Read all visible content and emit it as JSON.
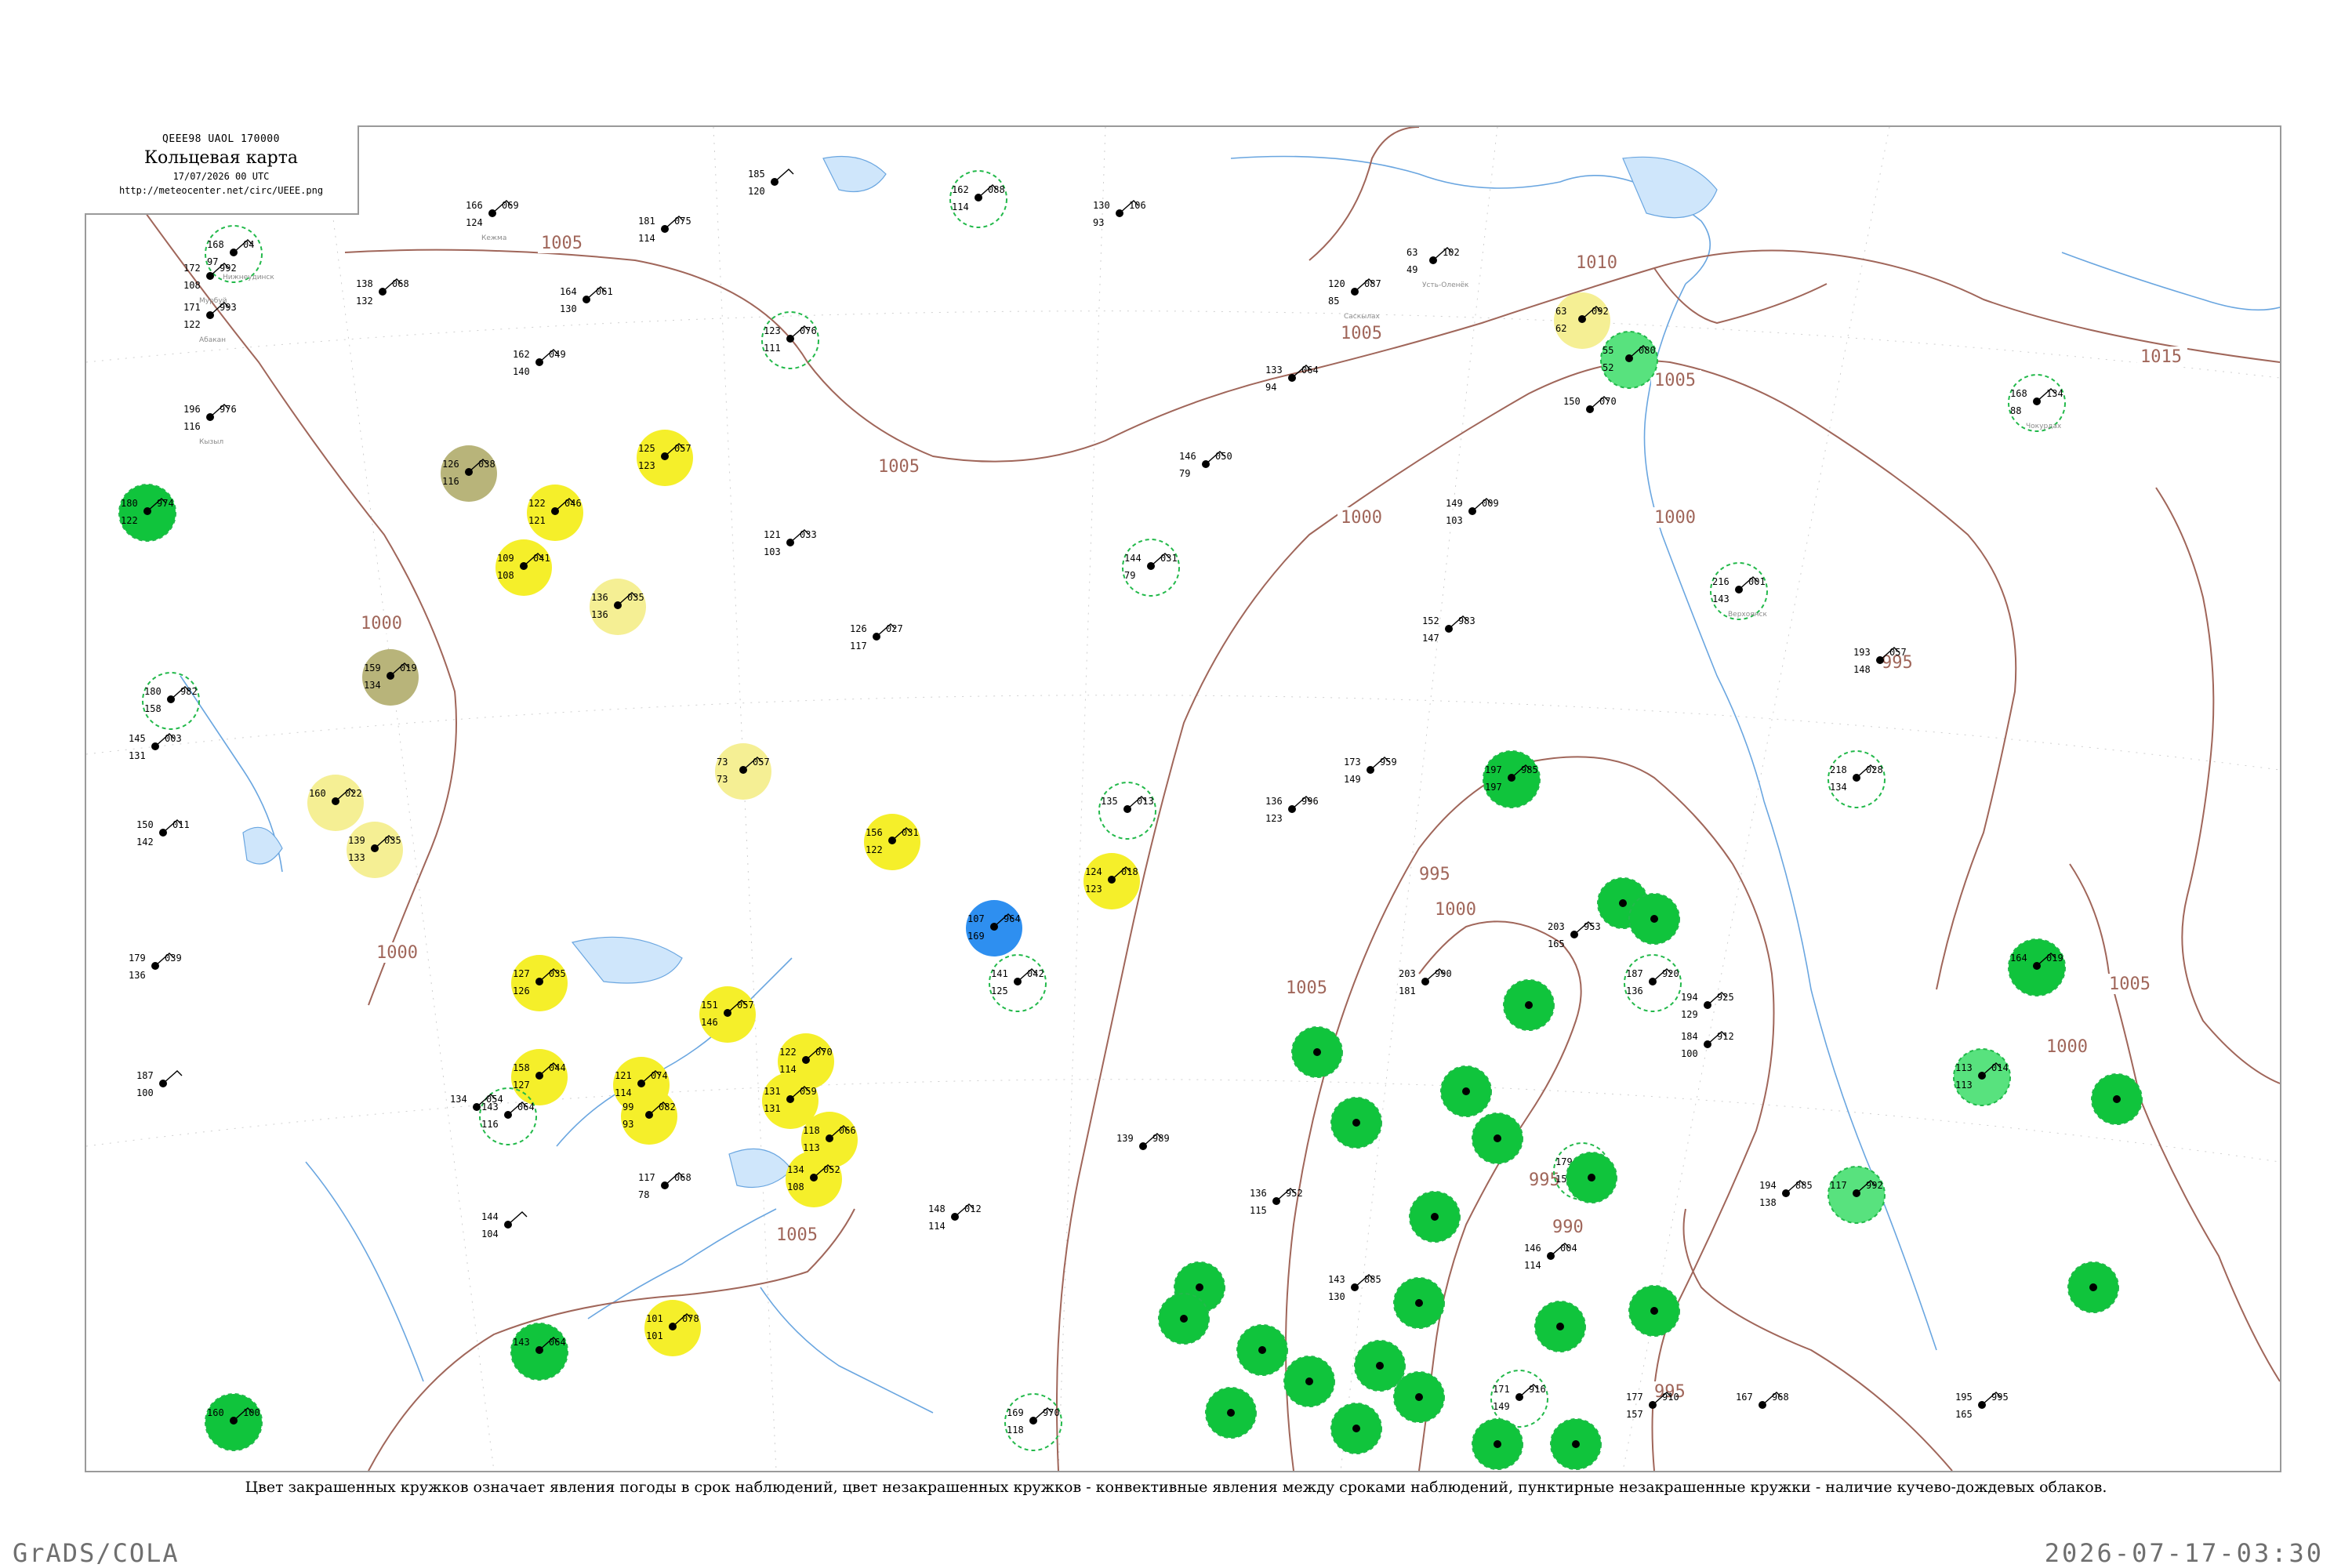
{
  "header": {
    "code_line": "QEEE98  UAOL  170000",
    "title": "Кольцевая карта",
    "datetime": "17/07/2026 00 UTC",
    "url": "http://meteocenter.net/circ/UEEE.png"
  },
  "footer_note": "Цвет закрашенных кружков означает явления погоды в срок наблюдений, цвет незакрашенных кружков - конвективные явления между сроками наблюдений, пунктирные незакрашенные кружки - наличие кучево-дождевых облаков.",
  "credit_left": "GrADS/COLA",
  "credit_right": "2026-07-17-03:30",
  "colors": {
    "isobar": "#a0665a",
    "water": "#6aa6e0",
    "fill_yellow": "#f5ef2a",
    "fill_pale_yellow": "#f5ef94",
    "fill_olive": "#b8b47a",
    "fill_green": "#10c43c",
    "fill_light_green": "#58e27e",
    "fill_blue": "#2e8ff0",
    "ring_green": "#22b94a"
  },
  "isobar_labels": [
    {
      "text": "1005"
    },
    {
      "text": "1005"
    },
    {
      "text": "1005"
    },
    {
      "text": "1010"
    },
    {
      "text": "1005"
    },
    {
      "text": "1015"
    },
    {
      "text": "1005"
    },
    {
      "text": "1000"
    },
    {
      "text": "1000"
    },
    {
      "text": "1000"
    },
    {
      "text": "1005"
    },
    {
      "text": "1000"
    },
    {
      "text": "995"
    },
    {
      "text": "1000"
    },
    {
      "text": "995"
    },
    {
      "text": "995"
    },
    {
      "text": "1005"
    },
    {
      "text": "990"
    },
    {
      "text": "995"
    },
    {
      "text": "1000"
    }
  ],
  "stations": [
    {
      "t": "168",
      "p": "04",
      "d": "97",
      "name": "Нижнеудинск",
      "fill": "none"
    },
    {
      "t": "172",
      "p": "992",
      "d": "108",
      "name": "Мурбуй",
      "fill": "none"
    },
    {
      "t": "171",
      "p": "993",
      "d": "122",
      "name": "Абакан",
      "fill": "none"
    },
    {
      "t": "196",
      "p": "976",
      "d": "116",
      "name": "Кызыл",
      "fill": "none"
    },
    {
      "t": "180",
      "p": "974",
      "d": "122",
      "name": "",
      "fill": "green"
    },
    {
      "t": "166",
      "p": "069",
      "d": "124",
      "name": "Кежма",
      "fill": "none"
    },
    {
      "t": "181",
      "p": "075",
      "d": "114",
      "name": "",
      "fill": "none"
    },
    {
      "t": "185",
      "p": "",
      "d": "120",
      "name": "",
      "fill": "none"
    },
    {
      "t": "162",
      "p": "088",
      "d": "114",
      "name": "",
      "fill": "none"
    },
    {
      "t": "130",
      "p": "106",
      "d": "93",
      "name": "",
      "fill": "none"
    },
    {
      "t": "63",
      "p": "102",
      "d": "49",
      "name": "Усть-Оленёк",
      "fill": "none"
    },
    {
      "t": "63",
      "p": "092",
      "d": "62",
      "name": "",
      "fill": "pale_yellow"
    },
    {
      "t": "55",
      "p": "080",
      "d": "52",
      "name": "",
      "fill": "light_green"
    },
    {
      "t": "120",
      "p": "087",
      "d": "85",
      "name": "Саскылах",
      "fill": "none"
    },
    {
      "t": "138",
      "p": "068",
      "d": "132",
      "name": "",
      "fill": "none"
    },
    {
      "t": "164",
      "p": "061",
      "d": "130",
      "name": "",
      "fill": "none"
    },
    {
      "t": "123",
      "p": "076",
      "d": "111",
      "name": "",
      "fill": "none"
    },
    {
      "t": "162",
      "p": "049",
      "d": "140",
      "name": "",
      "fill": "none"
    },
    {
      "t": "133",
      "p": "064",
      "d": "94",
      "name": "",
      "fill": "none"
    },
    {
      "t": "150",
      "p": "070",
      "d": "",
      "name": "",
      "fill": "none"
    },
    {
      "t": "168",
      "p": "134",
      "d": "88",
      "name": "Чокурдах",
      "fill": "none"
    },
    {
      "t": "126",
      "p": "038",
      "d": "116",
      "name": "",
      "fill": "olive"
    },
    {
      "t": "125",
      "p": "057",
      "d": "123",
      "name": "",
      "fill": "yellow"
    },
    {
      "t": "122",
      "p": "046",
      "d": "121",
      "name": "",
      "fill": "yellow"
    },
    {
      "t": "109",
      "p": "041",
      "d": "108",
      "name": "",
      "fill": "yellow"
    },
    {
      "t": "121",
      "p": "033",
      "d": "103",
      "name": "",
      "fill": "none"
    },
    {
      "t": "146",
      "p": "050",
      "d": "79",
      "name": "",
      "fill": "none"
    },
    {
      "t": "149",
      "p": "009",
      "d": "103",
      "name": "",
      "fill": "none"
    },
    {
      "t": "216",
      "p": "001",
      "d": "143",
      "name": "Верхоянск",
      "fill": "none"
    },
    {
      "t": "159",
      "p": "019",
      "d": "134",
      "name": "",
      "fill": "olive"
    },
    {
      "t": "136",
      "p": "035",
      "d": "136",
      "name": "",
      "fill": "pale_yellow"
    },
    {
      "t": "126",
      "p": "027",
      "d": "117",
      "name": "",
      "fill": "none"
    },
    {
      "t": "144",
      "p": "031",
      "d": "79",
      "name": "",
      "fill": "none"
    },
    {
      "t": "152",
      "p": "983",
      "d": "147",
      "name": "",
      "fill": "none"
    },
    {
      "t": "193",
      "p": "057",
      "d": "148",
      "name": "",
      "fill": "none"
    },
    {
      "t": "73",
      "p": "057",
      "d": "73",
      "name": "",
      "fill": "pale_yellow"
    },
    {
      "t": "160",
      "p": "022",
      "d": "",
      "name": "",
      "fill": "pale_yellow"
    },
    {
      "t": "139",
      "p": "035",
      "d": "133",
      "name": "",
      "fill": "pale_yellow"
    },
    {
      "t": "156",
      "p": "031",
      "d": "122",
      "name": "",
      "fill": "yellow"
    },
    {
      "t": "124",
      "p": "018",
      "d": "123",
      "name": "",
      "fill": "yellow"
    },
    {
      "t": "135",
      "p": "013",
      "d": "",
      "name": "",
      "fill": "none"
    },
    {
      "t": "136",
      "p": "996",
      "d": "123",
      "name": "",
      "fill": "none"
    },
    {
      "t": "173",
      "p": "959",
      "d": "149",
      "name": "",
      "fill": "none"
    },
    {
      "t": "197",
      "p": "985",
      "d": "197",
      "name": "",
      "fill": "green"
    },
    {
      "t": "218",
      "p": "028",
      "d": "134",
      "name": "",
      "fill": "none"
    },
    {
      "t": "107",
      "p": "964",
      "d": "169",
      "name": "",
      "fill": "blue"
    },
    {
      "t": "127",
      "p": "035",
      "d": "126",
      "name": "",
      "fill": "yellow"
    },
    {
      "t": "158",
      "p": "044",
      "d": "127",
      "name": "",
      "fill": "yellow"
    },
    {
      "t": "151",
      "p": "057",
      "d": "146",
      "name": "",
      "fill": "yellow"
    },
    {
      "t": "122",
      "p": "070",
      "d": "114",
      "name": "",
      "fill": "yellow"
    },
    {
      "t": "131",
      "p": "059",
      "d": "131",
      "name": "",
      "fill": "yellow"
    },
    {
      "t": "121",
      "p": "074",
      "d": "114",
      "name": "",
      "fill": "yellow"
    },
    {
      "t": "99",
      "p": "082",
      "d": "93",
      "name": "",
      "fill": "yellow"
    },
    {
      "t": "118",
      "p": "066",
      "d": "113",
      "name": "",
      "fill": "yellow"
    },
    {
      "t": "134",
      "p": "052",
      "d": "108",
      "name": "",
      "fill": "yellow"
    },
    {
      "t": "101",
      "p": "078",
      "d": "101",
      "name": "",
      "fill": "yellow"
    },
    {
      "t": "141",
      "p": "042",
      "d": "125",
      "name": "",
      "fill": "none"
    },
    {
      "t": "148",
      "p": "012",
      "d": "114",
      "name": "",
      "fill": "none"
    },
    {
      "t": "203",
      "p": "990",
      "d": "181",
      "name": "",
      "fill": "none"
    },
    {
      "t": "203",
      "p": "953",
      "d": "165",
      "name": "",
      "fill": "none"
    },
    {
      "t": "187",
      "p": "920",
      "d": "136",
      "name": "",
      "fill": "none"
    },
    {
      "t": "194",
      "p": "925",
      "d": "129",
      "name": "",
      "fill": "none"
    },
    {
      "t": "184",
      "p": "912",
      "d": "100",
      "name": "",
      "fill": "none"
    },
    {
      "t": "164",
      "p": "019",
      "d": "",
      "name": "",
      "fill": "green"
    },
    {
      "t": "113",
      "p": "014",
      "d": "113",
      "name": "",
      "fill": "light_green"
    },
    {
      "t": "117",
      "p": "992",
      "d": "",
      "name": "",
      "fill": "light_green"
    },
    {
      "t": "139",
      "p": "989",
      "d": "",
      "name": "",
      "fill": "none"
    },
    {
      "t": "136",
      "p": "952",
      "d": "115",
      "name": "",
      "fill": "none"
    },
    {
      "t": "179",
      "p": "084",
      "d": "151",
      "name": "",
      "fill": "none"
    },
    {
      "t": "194",
      "p": "885",
      "d": "138",
      "name": "",
      "fill": "none"
    },
    {
      "t": "146",
      "p": "004",
      "d": "114",
      "name": "",
      "fill": "none"
    },
    {
      "t": "143",
      "p": "885",
      "d": "130",
      "name": "",
      "fill": "none"
    },
    {
      "t": "171",
      "p": "916",
      "d": "149",
      "name": "",
      "fill": "none"
    },
    {
      "t": "177",
      "p": "910",
      "d": "157",
      "name": "",
      "fill": "none"
    },
    {
      "t": "167",
      "p": "968",
      "d": "",
      "name": "",
      "fill": "none"
    },
    {
      "t": "195",
      "p": "995",
      "d": "165",
      "name": "",
      "fill": "none"
    },
    {
      "t": "143",
      "p": "064",
      "d": "116",
      "name": "",
      "fill": "none"
    },
    {
      "t": "144",
      "p": "",
      "d": "104",
      "name": "",
      "fill": "none"
    },
    {
      "t": "117",
      "p": "068",
      "d": "78",
      "name": "",
      "fill": "none"
    },
    {
      "t": "134",
      "p": "054",
      "d": "",
      "name": "",
      "fill": "none"
    },
    {
      "t": "169",
      "p": "970",
      "d": "118",
      "name": "",
      "fill": "none"
    },
    {
      "t": "143",
      "p": "064",
      "d": "",
      "name": "",
      "fill": "green"
    },
    {
      "t": "160",
      "p": "100",
      "d": "",
      "name": "",
      "fill": "green"
    },
    {
      "t": "145",
      "p": "003",
      "d": "131",
      "name": "",
      "fill": "none"
    },
    {
      "t": "180",
      "p": "982",
      "d": "158",
      "name": "",
      "fill": "none"
    },
    {
      "t": "150",
      "p": "011",
      "d": "142",
      "name": "",
      "fill": "none"
    },
    {
      "t": "179",
      "p": "039",
      "d": "136",
      "name": "",
      "fill": "none"
    },
    {
      "t": "187",
      "p": "",
      "d": "100",
      "name": "",
      "fill": "none"
    }
  ],
  "filled_markers": [
    {
      "fill": "green"
    },
    {
      "fill": "green"
    },
    {
      "fill": "green"
    },
    {
      "fill": "green"
    },
    {
      "fill": "green"
    },
    {
      "fill": "green"
    },
    {
      "fill": "green"
    },
    {
      "fill": "green"
    },
    {
      "fill": "green"
    },
    {
      "fill": "green"
    },
    {
      "fill": "green"
    },
    {
      "fill": "green"
    },
    {
      "fill": "green"
    },
    {
      "fill": "green"
    },
    {
      "fill": "green"
    },
    {
      "fill": "green"
    },
    {
      "fill": "green"
    },
    {
      "fill": "green"
    },
    {
      "fill": "green"
    },
    {
      "fill": "green"
    },
    {
      "fill": "green"
    },
    {
      "fill": "green"
    },
    {
      "fill": "green"
    },
    {
      "fill": "green"
    },
    {
      "fill": "green"
    }
  ]
}
